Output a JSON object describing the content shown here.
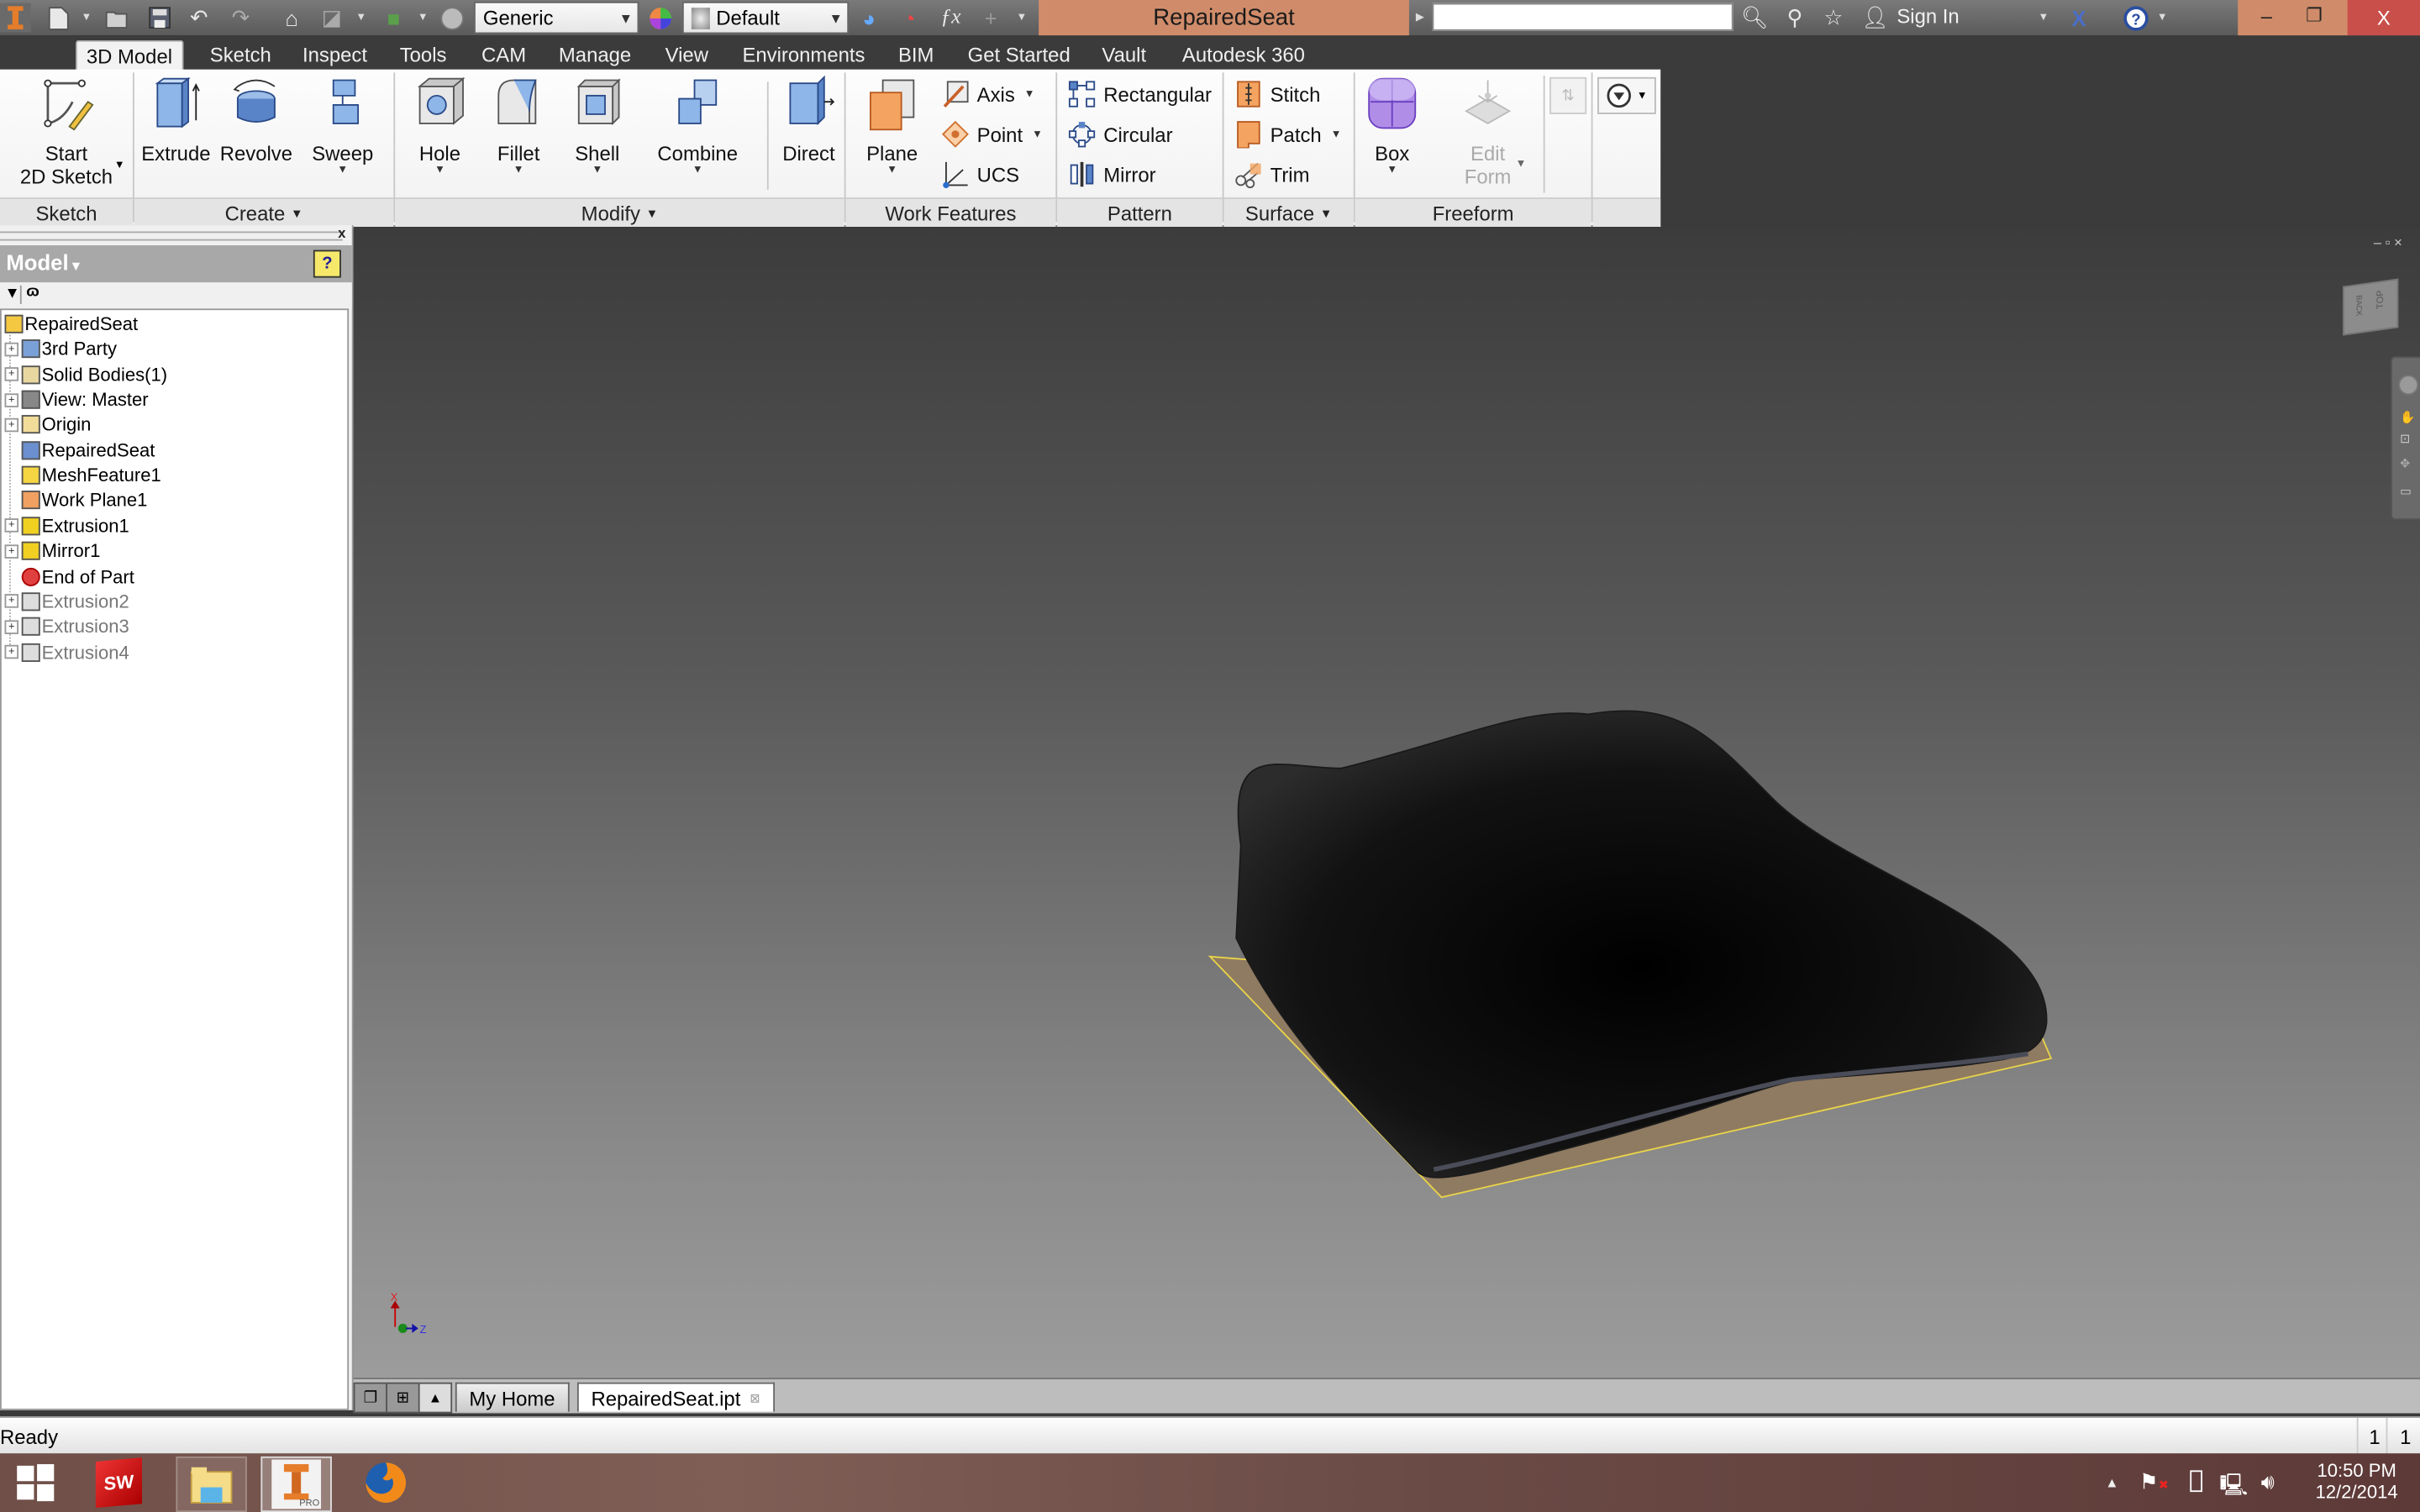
{
  "app": {
    "title": "RepairedSeat",
    "material_combo": "Generic",
    "appearance_combo": "Default",
    "search_placeholder": "",
    "sign_in": "Sign In",
    "close_glyph": "X",
    "minimize_glyph": "–",
    "restore_glyph": "❐"
  },
  "quick_access": [
    {
      "icon": "new-file-icon"
    },
    {
      "icon": "open-folder-icon"
    },
    {
      "icon": "save-icon"
    },
    {
      "icon": "undo-icon"
    },
    {
      "icon": "redo-icon"
    },
    {
      "icon": "home-icon"
    },
    {
      "icon": "update-icon"
    },
    {
      "icon": "select-icon"
    },
    {
      "icon": "material-icon"
    }
  ],
  "ribbon_tabs": [
    "3D Model",
    "Sketch",
    "Inspect",
    "Tools",
    "CAM",
    "Manage",
    "View",
    "Environments",
    "BIM",
    "Get Started",
    "Vault",
    "Autodesk 360"
  ],
  "active_tab": "3D Model",
  "panels": {
    "sketch": {
      "label": "Sketch",
      "start_sketch_line1": "Start",
      "start_sketch_line2": "2D Sketch"
    },
    "create": {
      "label": "Create",
      "extrude": "Extrude",
      "revolve": "Revolve",
      "sweep": "Sweep"
    },
    "modify": {
      "label": "Modify",
      "hole": "Hole",
      "fillet": "Fillet",
      "shell": "Shell",
      "combine": "Combine",
      "direct": "Direct"
    },
    "work_features": {
      "label": "Work Features",
      "plane": "Plane",
      "axis": "Axis",
      "point": "Point",
      "ucs": "UCS"
    },
    "pattern": {
      "label": "Pattern",
      "rectangular": "Rectangular",
      "circular": "Circular",
      "mirror": "Mirror"
    },
    "surface": {
      "label": "Surface",
      "stitch": "Stitch",
      "patch": "Patch",
      "trim": "Trim"
    },
    "freeform": {
      "label": "Freeform",
      "box": "Box",
      "edit_form_line1": "Edit",
      "edit_form_line2": "Form"
    }
  },
  "browser": {
    "title": "Model",
    "help": "?",
    "tree": [
      {
        "label": "RepairedSeat",
        "icon": "part-icon",
        "expandable": false,
        "dim": false,
        "level": 0
      },
      {
        "label": "3rd Party",
        "icon": "third-party-icon",
        "expandable": true,
        "dim": false,
        "level": 1
      },
      {
        "label": "Solid Bodies(1)",
        "icon": "solid-bodies-icon",
        "expandable": true,
        "dim": false,
        "level": 1
      },
      {
        "label": "View: Master",
        "icon": "view-rep-icon",
        "expandable": true,
        "dim": false,
        "level": 1
      },
      {
        "label": "Origin",
        "icon": "folder-icon",
        "expandable": true,
        "dim": false,
        "level": 1
      },
      {
        "label": "RepairedSeat",
        "icon": "mesh-body-icon",
        "expandable": false,
        "dim": false,
        "level": 1
      },
      {
        "label": "MeshFeature1",
        "icon": "mesh-feature-icon",
        "expandable": false,
        "dim": false,
        "level": 1
      },
      {
        "label": "Work Plane1",
        "icon": "work-plane-icon",
        "expandable": false,
        "dim": false,
        "level": 1
      },
      {
        "label": "Extrusion1",
        "icon": "extrusion-icon",
        "expandable": true,
        "dim": false,
        "level": 1
      },
      {
        "label": "Mirror1",
        "icon": "mirror-icon",
        "expandable": true,
        "dim": false,
        "level": 1
      },
      {
        "label": "End of Part",
        "icon": "end-of-part-icon",
        "expandable": false,
        "dim": false,
        "level": 1
      },
      {
        "label": "Extrusion2",
        "icon": "extrusion-icon",
        "expandable": true,
        "dim": true,
        "level": 1
      },
      {
        "label": "Extrusion3",
        "icon": "extrusion-icon",
        "expandable": true,
        "dim": true,
        "level": 1
      },
      {
        "label": "Extrusion4",
        "icon": "extrusion-icon",
        "expandable": true,
        "dim": true,
        "level": 1
      }
    ]
  },
  "viewcube": {
    "faces": [
      "TOP",
      "BACK"
    ]
  },
  "triad": {
    "x": "X",
    "z": "Z"
  },
  "document_tabs": [
    {
      "label": "My Home",
      "active": false
    },
    {
      "label": "RepairedSeat.ipt",
      "active": true
    }
  ],
  "status": {
    "text": "Ready",
    "num1": "1",
    "num2": "1"
  },
  "taskbar": {
    "apps": [
      "start-button",
      "solidworks",
      "file-explorer",
      "inventor-pro",
      "firefox"
    ],
    "inventor_badge": "PRO",
    "solidworks_badge": "SW",
    "time": "10:50 PM",
    "date": "12/2/2014"
  },
  "colors": {
    "title_accent": "#d08c6a",
    "close_red": "#c94f4a",
    "ribbon_tab_bg": "#3b3b3b",
    "model_black": "#0d0d0d",
    "plane_tan": "#9b8468",
    "plane_edge": "#e8d24a"
  }
}
